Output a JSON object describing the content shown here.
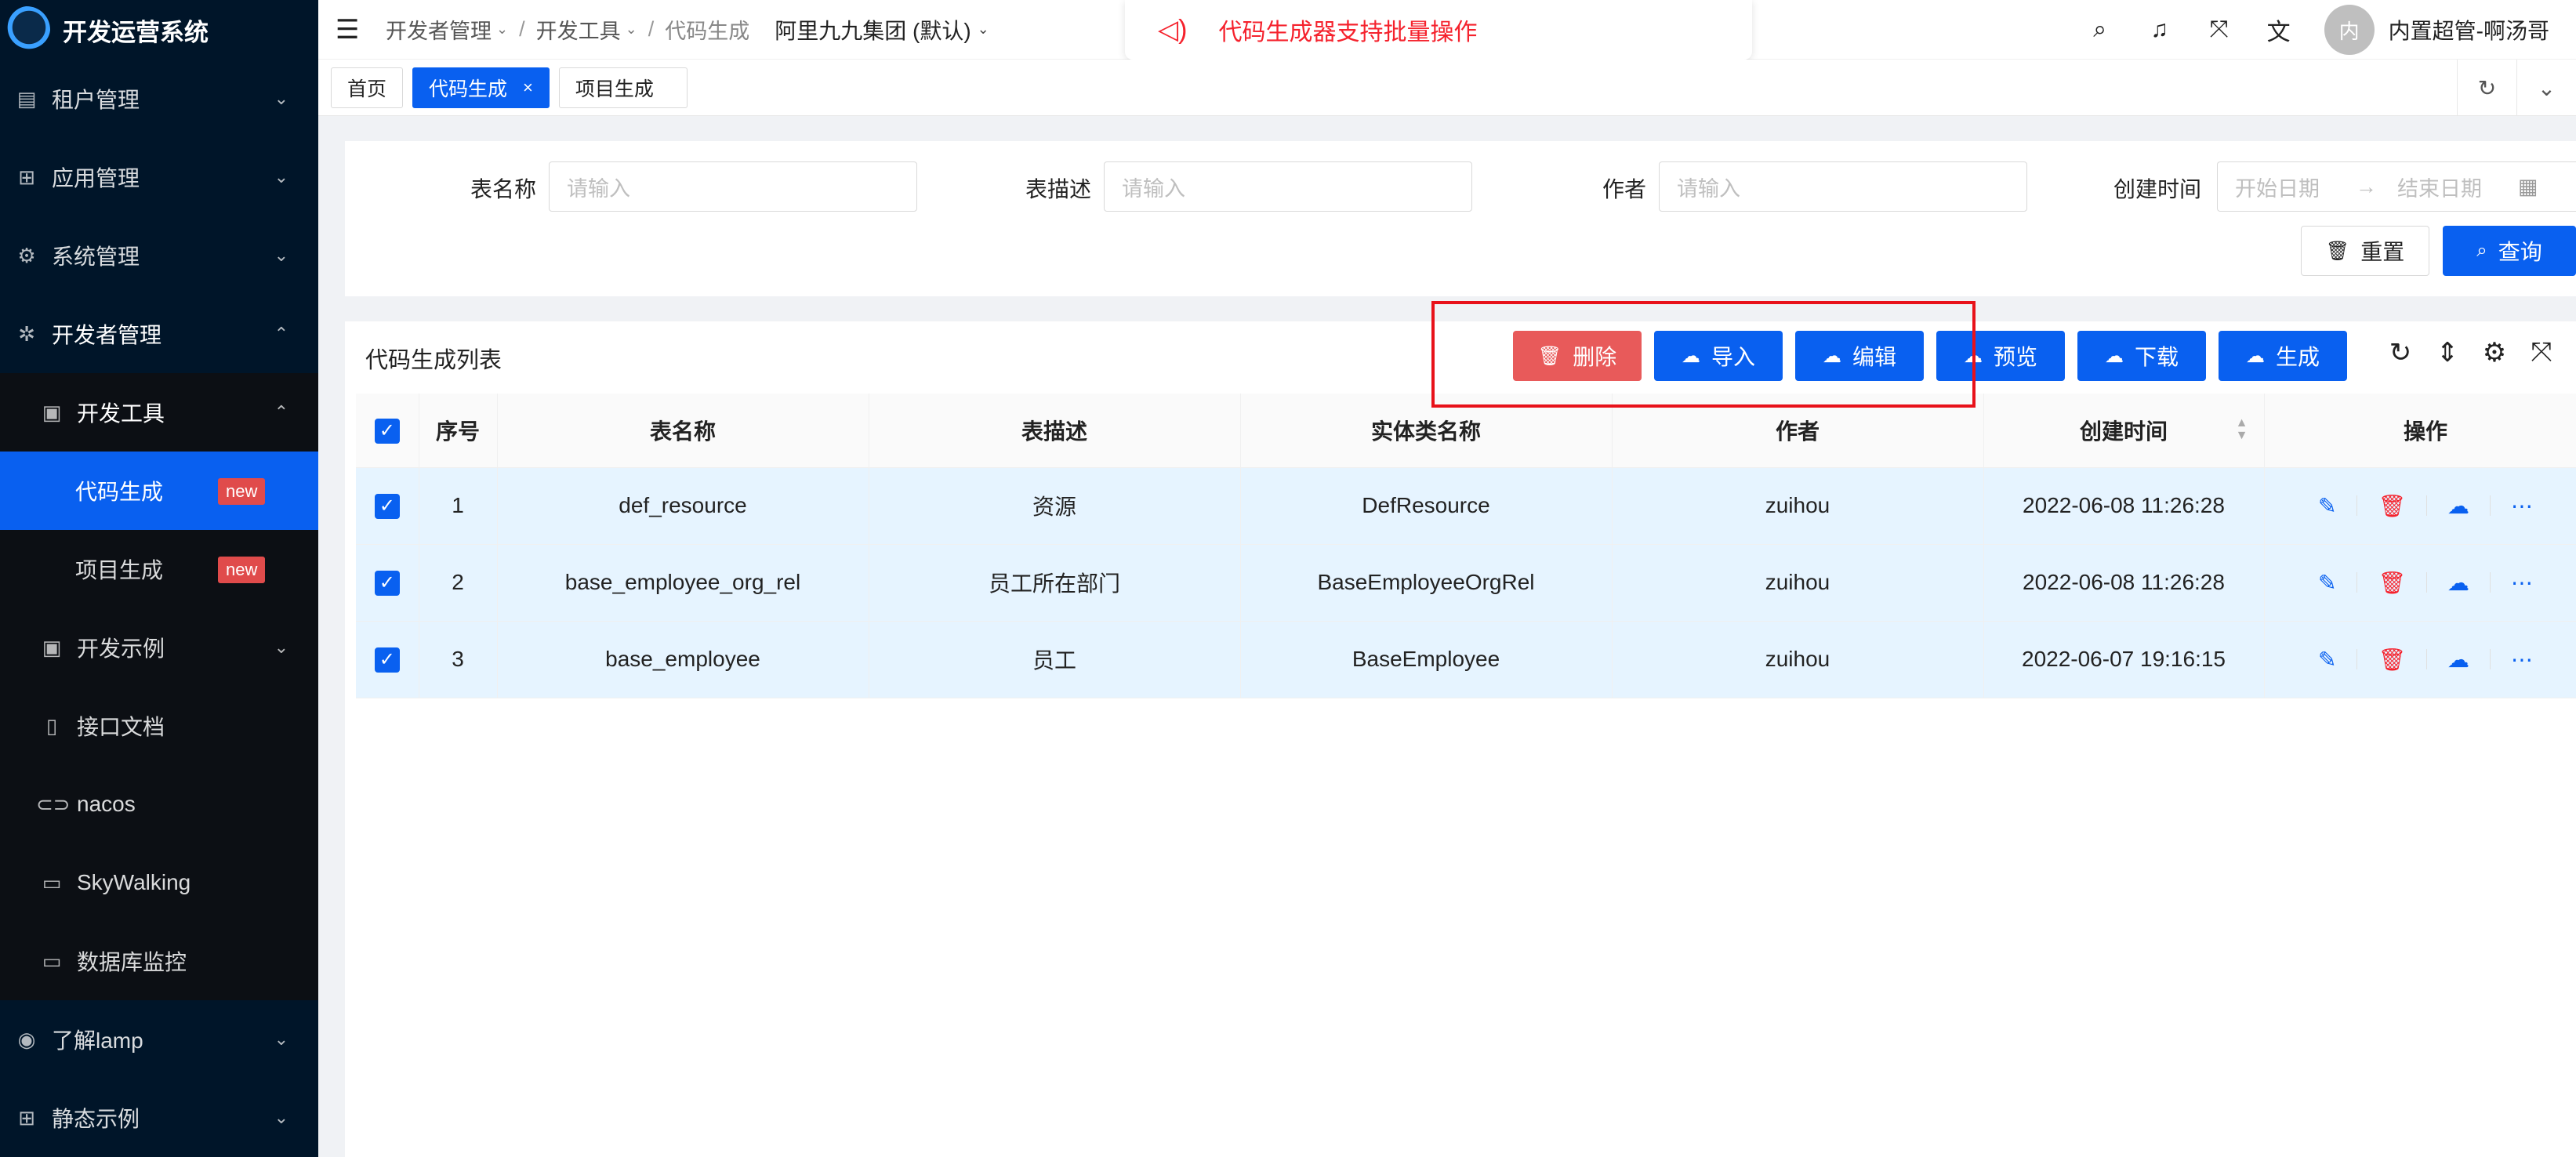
{
  "app": {
    "title": "开发运营系统"
  },
  "sidebar": {
    "items": [
      {
        "label": "租户管理",
        "icon": "building-icon"
      },
      {
        "label": "应用管理",
        "icon": "apps-icon"
      },
      {
        "label": "系统管理",
        "icon": "gear-icon"
      },
      {
        "label": "开发者管理",
        "icon": "bug-icon"
      },
      {
        "label": "开发工具",
        "icon": "terminal-icon"
      },
      {
        "label": "代码生成",
        "badge": "new"
      },
      {
        "label": "项目生成",
        "badge": "new"
      },
      {
        "label": "开发示例",
        "icon": "terminal-icon"
      },
      {
        "label": "接口文档",
        "icon": "document-icon"
      },
      {
        "label": "nacos",
        "icon": "link-icon"
      },
      {
        "label": "SkyWalking",
        "icon": "monitor-icon"
      },
      {
        "label": "数据库监控",
        "icon": "database-icon"
      },
      {
        "label": "了解lamp",
        "icon": "github-icon"
      },
      {
        "label": "静态示例",
        "icon": "table-icon"
      }
    ]
  },
  "header": {
    "breadcrumb": [
      "开发者管理",
      "开发工具",
      "代码生成"
    ],
    "tenant": "阿里九九集团 (默认)",
    "notice": "代码生成器支持批量操作",
    "avatar_text": "内",
    "username": "内置超管-啊汤哥"
  },
  "tabs": [
    "首页",
    "代码生成",
    "项目生成"
  ],
  "search": {
    "fields": [
      {
        "label": "表名称",
        "placeholder": "请输入"
      },
      {
        "label": "表描述",
        "placeholder": "请输入"
      },
      {
        "label": "作者",
        "placeholder": "请输入"
      }
    ],
    "date_label": "创建时间",
    "date_start": "开始日期",
    "date_end": "结束日期",
    "reset": "重置",
    "query": "查询"
  },
  "list": {
    "title": "代码生成列表",
    "buttons": {
      "delete": "删除",
      "import": "导入",
      "edit": "编辑",
      "preview": "预览",
      "download": "下载",
      "generate": "生成"
    },
    "columns": [
      "序号",
      "表名称",
      "表描述",
      "实体类名称",
      "作者",
      "创建时间",
      "操作"
    ],
    "rows": [
      {
        "no": "1",
        "table": "def_resource",
        "desc": "资源",
        "entity": "DefResource",
        "author": "zuihou",
        "time": "2022-06-08 11:26:28"
      },
      {
        "no": "2",
        "table": "base_employee_org_rel",
        "desc": "员工所在部门",
        "entity": "BaseEmployeeOrgRel",
        "author": "zuihou",
        "time": "2022-06-08 11:26:28"
      },
      {
        "no": "3",
        "table": "base_employee",
        "desc": "员工",
        "entity": "BaseEmployee",
        "author": "zuihou",
        "time": "2022-06-07 19:16:15"
      }
    ]
  },
  "colors": {
    "primary": "#0960f0",
    "danger": "#e85a5a",
    "highlight": "#e8121a",
    "sidebar": "#001529"
  }
}
